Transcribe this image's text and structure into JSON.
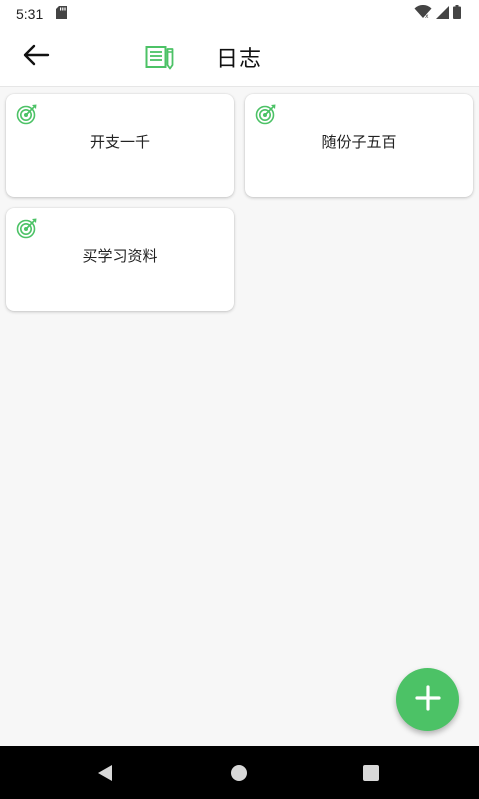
{
  "status_bar": {
    "time": "5:31",
    "icons": [
      "sd-card-icon",
      "wifi-icon",
      "cell-signal-icon",
      "battery-icon"
    ]
  },
  "toolbar": {
    "title": "日志",
    "back_icon": "arrow-left-icon",
    "title_icon": "notebook-pencil-icon"
  },
  "cards": [
    {
      "label": "开支一千",
      "icon": "target-icon"
    },
    {
      "label": "随份子五百",
      "icon": "target-icon"
    },
    {
      "label": "买学习资料",
      "icon": "target-icon"
    }
  ],
  "fab": {
    "icon": "plus-icon"
  },
  "nav_bar": {
    "icons": [
      "nav-back-icon",
      "nav-home-icon",
      "nav-recents-icon"
    ]
  },
  "colors": {
    "accent": "#4cc266",
    "background": "#f7f7f7",
    "card": "#ffffff",
    "nav_bar": "#000000"
  }
}
